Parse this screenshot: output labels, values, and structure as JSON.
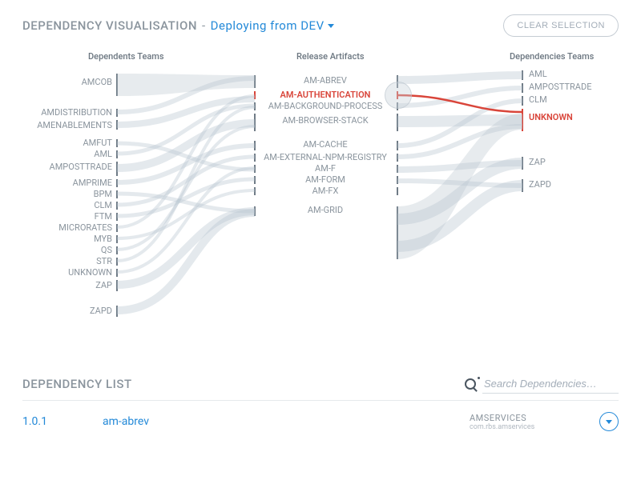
{
  "header": {
    "title": "DEPENDENCY VISUALISATION",
    "subtitle": "Deploying from DEV",
    "clear_btn": "CLEAR SELECTION"
  },
  "columns": {
    "c1": "Dependents Teams",
    "c2": "Release Artifacts",
    "c3": "Dependencies Teams"
  },
  "dependents": [
    "AMCOB",
    "AMDISTRIBUTION",
    "AMENABLEMENTS",
    "AMFUT",
    "AML",
    "AMPOSTTRADE",
    "AMPRIME",
    "BPM",
    "CLM",
    "FTM",
    "MICRORATES",
    "MYB",
    "QS",
    "STR",
    "UNKNOWN",
    "ZAP",
    "ZAPD"
  ],
  "artifacts": [
    "AM-ABREV",
    "AM-AUTHENTICATION",
    "AM-BACKGROUND-PROCESS",
    "AM-BROWSER-STACK",
    "AM-CACHE",
    "AM-EXTERNAL-NPM-REGISTRY",
    "AM-F",
    "AM-FORM",
    "AM-FX",
    "AM-GRID"
  ],
  "dependencies": [
    "AML",
    "AMPOSTTRADE",
    "CLM",
    "UNKNOWN",
    "ZAP",
    "ZAPD"
  ],
  "highlighted_artifact": "AM-AUTHENTICATION",
  "highlighted_dependency": "UNKNOWN",
  "list": {
    "title": "DEPENDENCY LIST",
    "search_placeholder": "Search Dependencies…",
    "rows": [
      {
        "version": "1.0.1",
        "name": "am-abrev",
        "service": "AMSERVICES",
        "package": "com.rbs.amservices"
      }
    ]
  }
}
